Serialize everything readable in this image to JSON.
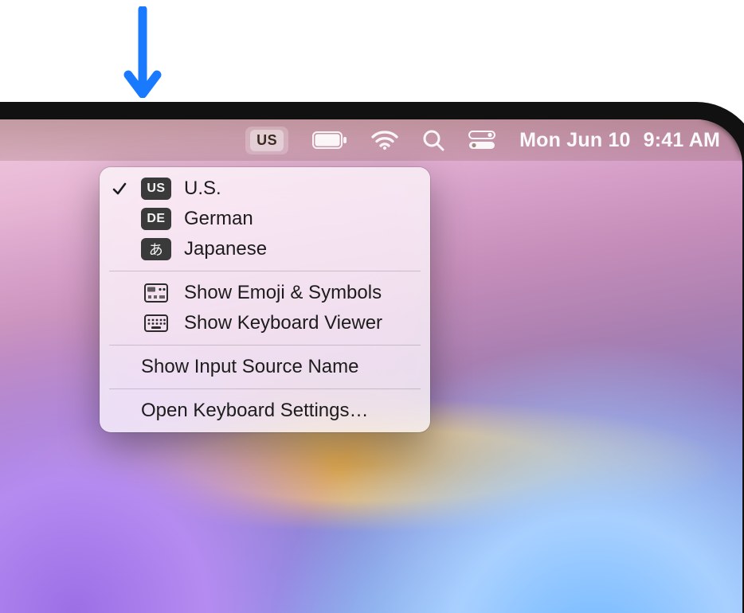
{
  "pointer": {
    "color": "#1979ff"
  },
  "menubar": {
    "input_source_badge": "US",
    "date": "Mon Jun 10",
    "time": "9:41 AM"
  },
  "dropdown": {
    "sources": [
      {
        "badge": "US",
        "label": "U.S.",
        "checked": true,
        "kind": "latin"
      },
      {
        "badge": "DE",
        "label": "German",
        "checked": false,
        "kind": "latin"
      },
      {
        "badge": "あ",
        "label": "Japanese",
        "checked": false,
        "kind": "jp"
      }
    ],
    "show_emoji": "Show Emoji & Symbols",
    "show_keyboard_viewer": "Show Keyboard Viewer",
    "show_input_source_name": "Show Input Source Name",
    "open_keyboard_settings": "Open Keyboard Settings…"
  }
}
